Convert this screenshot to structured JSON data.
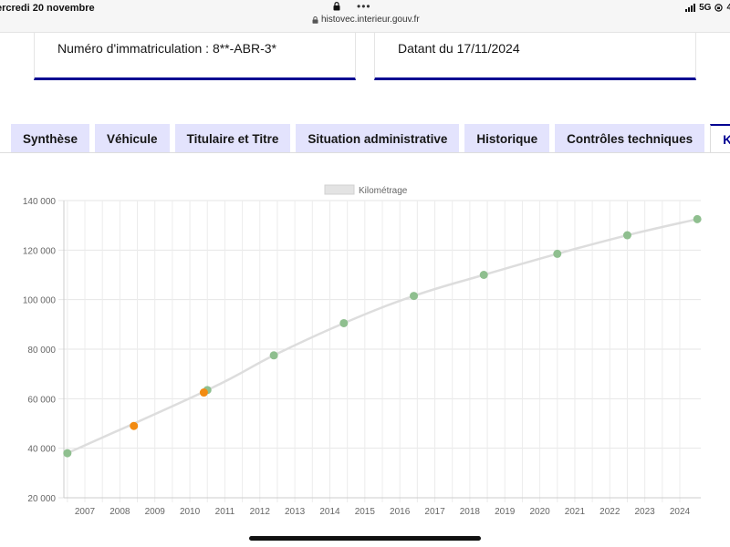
{
  "status_bar": {
    "date": "ercredi 20 novembre",
    "dots": "•••",
    "url": "histovec.interieur.gouv.fr",
    "network": "5G",
    "battery_partial": "4"
  },
  "cards": {
    "registration": "Numéro d'immatriculation : 8**-ABR-3*",
    "date": "Datant du 17/11/2024"
  },
  "tabs": [
    {
      "label": "Synthèse"
    },
    {
      "label": "Véhicule"
    },
    {
      "label": "Titulaire et Titre"
    },
    {
      "label": "Situation administrative"
    },
    {
      "label": "Historique"
    },
    {
      "label": "Contrôles techniques"
    },
    {
      "label": "Kilo"
    }
  ],
  "colors": {
    "accent": "#000091",
    "tab_bg": "#e3e3fd",
    "point_normal": "#8fbf8f",
    "point_alert": "#f28b12",
    "line": "#dddddd"
  },
  "chart_data": {
    "type": "line",
    "legend": "Kilométrage",
    "legend_position": "top",
    "grid": true,
    "x_ticks": [
      2007,
      2008,
      2009,
      2010,
      2011,
      2012,
      2013,
      2014,
      2015,
      2016,
      2017,
      2018,
      2019,
      2020,
      2021,
      2022,
      2023,
      2024
    ],
    "xlim": [
      2006.4,
      2024.6
    ],
    "y_ticks": [
      "20 000",
      "40 000",
      "60 000",
      "80 000",
      "100 000",
      "120 000",
      "140 000"
    ],
    "ylim": [
      20000,
      140000
    ],
    "series": [
      {
        "values": [
          {
            "x": 2006.5,
            "y": 38000
          },
          {
            "x": 2010.5,
            "y": 63500
          },
          {
            "x": 2012.4,
            "y": 77500
          },
          {
            "x": 2014.4,
            "y": 90500
          },
          {
            "x": 2016.4,
            "y": 101500
          },
          {
            "x": 2018.4,
            "y": 110000
          },
          {
            "x": 2020.5,
            "y": 118500
          },
          {
            "x": 2022.5,
            "y": 126000
          },
          {
            "x": 2024.5,
            "y": 132500
          }
        ]
      }
    ],
    "alert_points": [
      {
        "x": 2008.4,
        "y": 49000
      },
      {
        "x": 2010.4,
        "y": 62500
      }
    ]
  }
}
